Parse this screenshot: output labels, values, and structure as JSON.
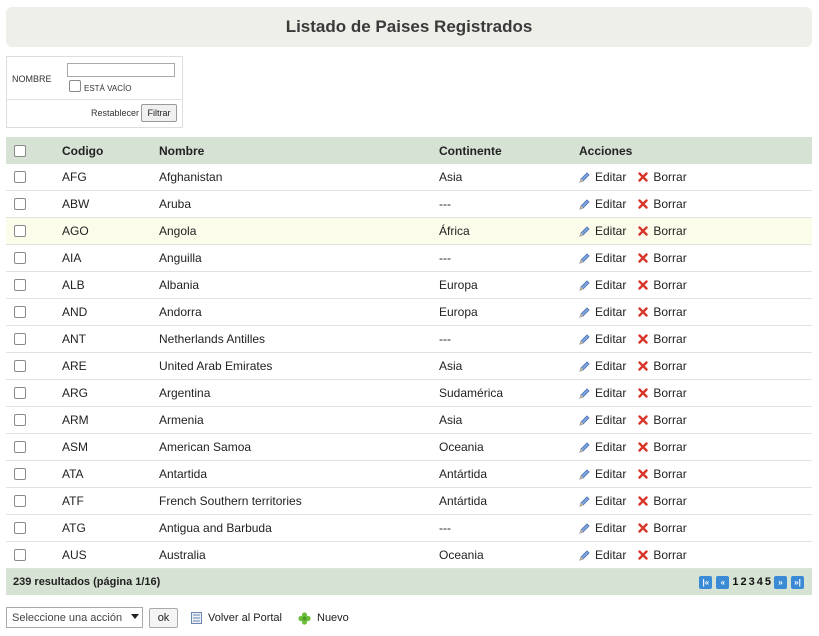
{
  "header": {
    "title": "Listado de Paises Registrados"
  },
  "filter": {
    "name_label": "NOMBRE",
    "name_value": "",
    "empty_label": "ESTÁ VACÍO",
    "reset_label": "Restablecer",
    "filter_button": "Filtrar"
  },
  "grid": {
    "columns": [
      "Codigo",
      "Nombre",
      "Continente",
      "Acciones"
    ],
    "edit_label": "Editar",
    "delete_label": "Borrar",
    "rows": [
      {
        "code": "AFG",
        "name": "Afghanistan",
        "continent": "Asia"
      },
      {
        "code": "ABW",
        "name": "Aruba",
        "continent": "---"
      },
      {
        "code": "AGO",
        "name": "Angola",
        "continent": "África"
      },
      {
        "code": "AIA",
        "name": "Anguilla",
        "continent": "---"
      },
      {
        "code": "ALB",
        "name": "Albania",
        "continent": "Europa"
      },
      {
        "code": "AND",
        "name": "Andorra",
        "continent": "Europa"
      },
      {
        "code": "ANT",
        "name": "Netherlands Antilles",
        "continent": "---"
      },
      {
        "code": "ARE",
        "name": "United Arab Emirates",
        "continent": "Asia"
      },
      {
        "code": "ARG",
        "name": "Argentina",
        "continent": "Sudamérica"
      },
      {
        "code": "ARM",
        "name": "Armenia",
        "continent": "Asia"
      },
      {
        "code": "ASM",
        "name": "American Samoa",
        "continent": "Oceania"
      },
      {
        "code": "ATA",
        "name": "Antartida",
        "continent": "Antártida"
      },
      {
        "code": "ATF",
        "name": "French Southern territories",
        "continent": "Antártida"
      },
      {
        "code": "ATG",
        "name": "Antigua and Barbuda",
        "continent": "---"
      },
      {
        "code": "AUS",
        "name": "Australia",
        "continent": "Oceania"
      }
    ]
  },
  "footer": {
    "results": "239 resultados (página 1/16)",
    "pages": [
      "1",
      "2",
      "3",
      "4",
      "5"
    ]
  },
  "bottom": {
    "action_select": "Seleccione una acción",
    "ok_button": "ok",
    "back_link": "Volver al Portal",
    "new_link": "Nuevo"
  },
  "colors": {
    "header_bg": "#d6e2d4",
    "title_bg": "#efefe9",
    "delete_red": "#d9362b",
    "edit_blue": "#4a7bc8",
    "pager_blue": "#3a8ad6",
    "new_green": "#5cb030"
  }
}
